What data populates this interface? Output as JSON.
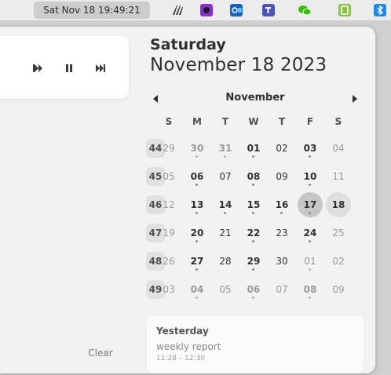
{
  "topbar": {
    "clock": "Sat Nov 18  19:49:21",
    "tray_icons": [
      {
        "name": "focuswriter-icon",
        "color": "#2d2d2d"
      },
      {
        "name": "obs-icon",
        "color": "#8a2bd6"
      },
      {
        "name": "outlook-icon",
        "color": "#1565c0"
      },
      {
        "name": "teams-icon",
        "color": "#4b53bc"
      },
      {
        "name": "wechat-icon",
        "color": "#2ec100"
      },
      {
        "name": "clipboard-icon",
        "color": "#8bc34a"
      },
      {
        "name": "bluetooth-icon",
        "color": "#1e88e5"
      }
    ]
  },
  "media": {
    "prev_icon": "skip-previous-icon",
    "pause_icon": "pause-icon",
    "next_icon": "skip-next-icon"
  },
  "notifications": {
    "clear_label": "Clear"
  },
  "calendar": {
    "weekday": "Saturday",
    "full_date": "November 18 2023",
    "month": "November",
    "day_headers": [
      "S",
      "M",
      "T",
      "W",
      "T",
      "F",
      "S"
    ],
    "weeks": [
      {
        "num": "44",
        "days": [
          {
            "d": "29",
            "other": true,
            "bold": false,
            "dot": false
          },
          {
            "d": "30",
            "other": true,
            "bold": true,
            "dot": true
          },
          {
            "d": "31",
            "other": true,
            "bold": true,
            "dot": true
          },
          {
            "d": "01",
            "other": false,
            "bold": true,
            "dot": true
          },
          {
            "d": "02",
            "other": false,
            "bold": false,
            "dot": false
          },
          {
            "d": "03",
            "other": false,
            "bold": true,
            "dot": true
          },
          {
            "d": "04",
            "other": false,
            "bold": false,
            "dot": false,
            "dim": true
          }
        ]
      },
      {
        "num": "45",
        "days": [
          {
            "d": "05",
            "other": false,
            "bold": false,
            "dot": false,
            "dim": true
          },
          {
            "d": "06",
            "other": false,
            "bold": true,
            "dot": true
          },
          {
            "d": "07",
            "other": false,
            "bold": false,
            "dot": false
          },
          {
            "d": "08",
            "other": false,
            "bold": true,
            "dot": true
          },
          {
            "d": "09",
            "other": false,
            "bold": false,
            "dot": false
          },
          {
            "d": "10",
            "other": false,
            "bold": true,
            "dot": true
          },
          {
            "d": "11",
            "other": false,
            "bold": false,
            "dot": false,
            "dim": true
          }
        ]
      },
      {
        "num": "46",
        "days": [
          {
            "d": "12",
            "other": false,
            "bold": false,
            "dot": false,
            "dim": true
          },
          {
            "d": "13",
            "other": false,
            "bold": true,
            "dot": true
          },
          {
            "d": "14",
            "other": false,
            "bold": true,
            "dot": true
          },
          {
            "d": "15",
            "other": false,
            "bold": true,
            "dot": true
          },
          {
            "d": "16",
            "other": false,
            "bold": true,
            "dot": true
          },
          {
            "d": "17",
            "other": false,
            "bold": true,
            "dot": true,
            "today": true
          },
          {
            "d": "18",
            "other": false,
            "bold": true,
            "dot": false,
            "selected": true
          }
        ]
      },
      {
        "num": "47",
        "days": [
          {
            "d": "19",
            "other": false,
            "bold": false,
            "dot": false,
            "dim": true
          },
          {
            "d": "20",
            "other": false,
            "bold": true,
            "dot": true
          },
          {
            "d": "21",
            "other": false,
            "bold": false,
            "dot": false
          },
          {
            "d": "22",
            "other": false,
            "bold": true,
            "dot": true
          },
          {
            "d": "23",
            "other": false,
            "bold": false,
            "dot": false
          },
          {
            "d": "24",
            "other": false,
            "bold": true,
            "dot": true
          },
          {
            "d": "25",
            "other": false,
            "bold": false,
            "dot": false,
            "dim": true
          }
        ]
      },
      {
        "num": "48",
        "days": [
          {
            "d": "26",
            "other": false,
            "bold": false,
            "dot": false,
            "dim": true
          },
          {
            "d": "27",
            "other": false,
            "bold": true,
            "dot": true
          },
          {
            "d": "28",
            "other": false,
            "bold": false,
            "dot": false
          },
          {
            "d": "29",
            "other": false,
            "bold": true,
            "dot": true
          },
          {
            "d": "30",
            "other": false,
            "bold": false,
            "dot": false
          },
          {
            "d": "01",
            "other": true,
            "bold": false,
            "dot": true
          },
          {
            "d": "02",
            "other": true,
            "bold": false,
            "dot": false
          }
        ]
      },
      {
        "num": "49",
        "days": [
          {
            "d": "03",
            "other": true,
            "bold": false,
            "dot": false
          },
          {
            "d": "04",
            "other": true,
            "bold": true,
            "dot": true
          },
          {
            "d": "05",
            "other": true,
            "bold": false,
            "dot": false
          },
          {
            "d": "06",
            "other": true,
            "bold": true,
            "dot": true
          },
          {
            "d": "07",
            "other": true,
            "bold": false,
            "dot": false
          },
          {
            "d": "08",
            "other": true,
            "bold": true,
            "dot": true
          },
          {
            "d": "09",
            "other": true,
            "bold": false,
            "dot": false
          }
        ]
      }
    ]
  },
  "events": {
    "heading": "Yesterday",
    "items": [
      {
        "title": "weekly report",
        "time": "11:28 – 12:30"
      }
    ]
  }
}
